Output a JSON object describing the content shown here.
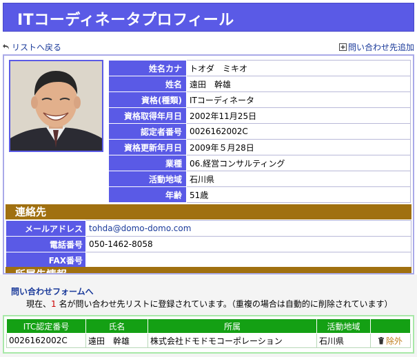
{
  "header": {
    "title": "ITコーディネータプロフィール"
  },
  "nav": {
    "back_label": "リストへ戻る",
    "add_label": "問い合わせ先追加"
  },
  "profile": {
    "rows": [
      {
        "label": "姓名カナ",
        "value": "トオダ　ミキオ"
      },
      {
        "label": "姓名",
        "value": "遠田　幹雄"
      },
      {
        "label": "資格(種類)",
        "value": "ITコーディネータ"
      },
      {
        "label": "資格取得年月日",
        "value": "2002年11月25日"
      },
      {
        "label": "認定者番号",
        "value": "0026162002C"
      },
      {
        "label": "資格更新年月日",
        "value": "2009年５月28日"
      },
      {
        "label": "業種",
        "value": "06.経営コンサルティング"
      },
      {
        "label": "活動地域",
        "value": "石川県"
      },
      {
        "label": "年齢",
        "value": "51歳"
      }
    ]
  },
  "contact": {
    "heading": "連絡先",
    "rows": [
      {
        "label": "メールアドレス",
        "value": "tohda@domo-domo.com"
      },
      {
        "label": "電話番号",
        "value": "050-1462-8058"
      },
      {
        "label": "FAX番号",
        "value": ""
      }
    ]
  },
  "affiliation": {
    "heading": "所属先情報"
  },
  "inquiry": {
    "form_link": "問い合わせフォームへ",
    "status_prefix": "現在、",
    "status_count": "1",
    "status_suffix": " 名が問い合わせ先リストに登録されています。（重複の場合は自動的に削除されています）"
  },
  "itc_list": {
    "headers": [
      "ITC認定番号",
      "氏名",
      "所属",
      "活動地域",
      ""
    ],
    "rows": [
      {
        "id": "0026162002C",
        "name": "遠田　幹雄",
        "org": "株式会社ドモドモコーポレーション",
        "region": "石川県",
        "action": "除外"
      }
    ]
  },
  "colors": {
    "title_bg": "#5a5ae6",
    "section_bg": "#a07010",
    "list_header_bg": "#14a014",
    "link": "#1a3a9a"
  }
}
